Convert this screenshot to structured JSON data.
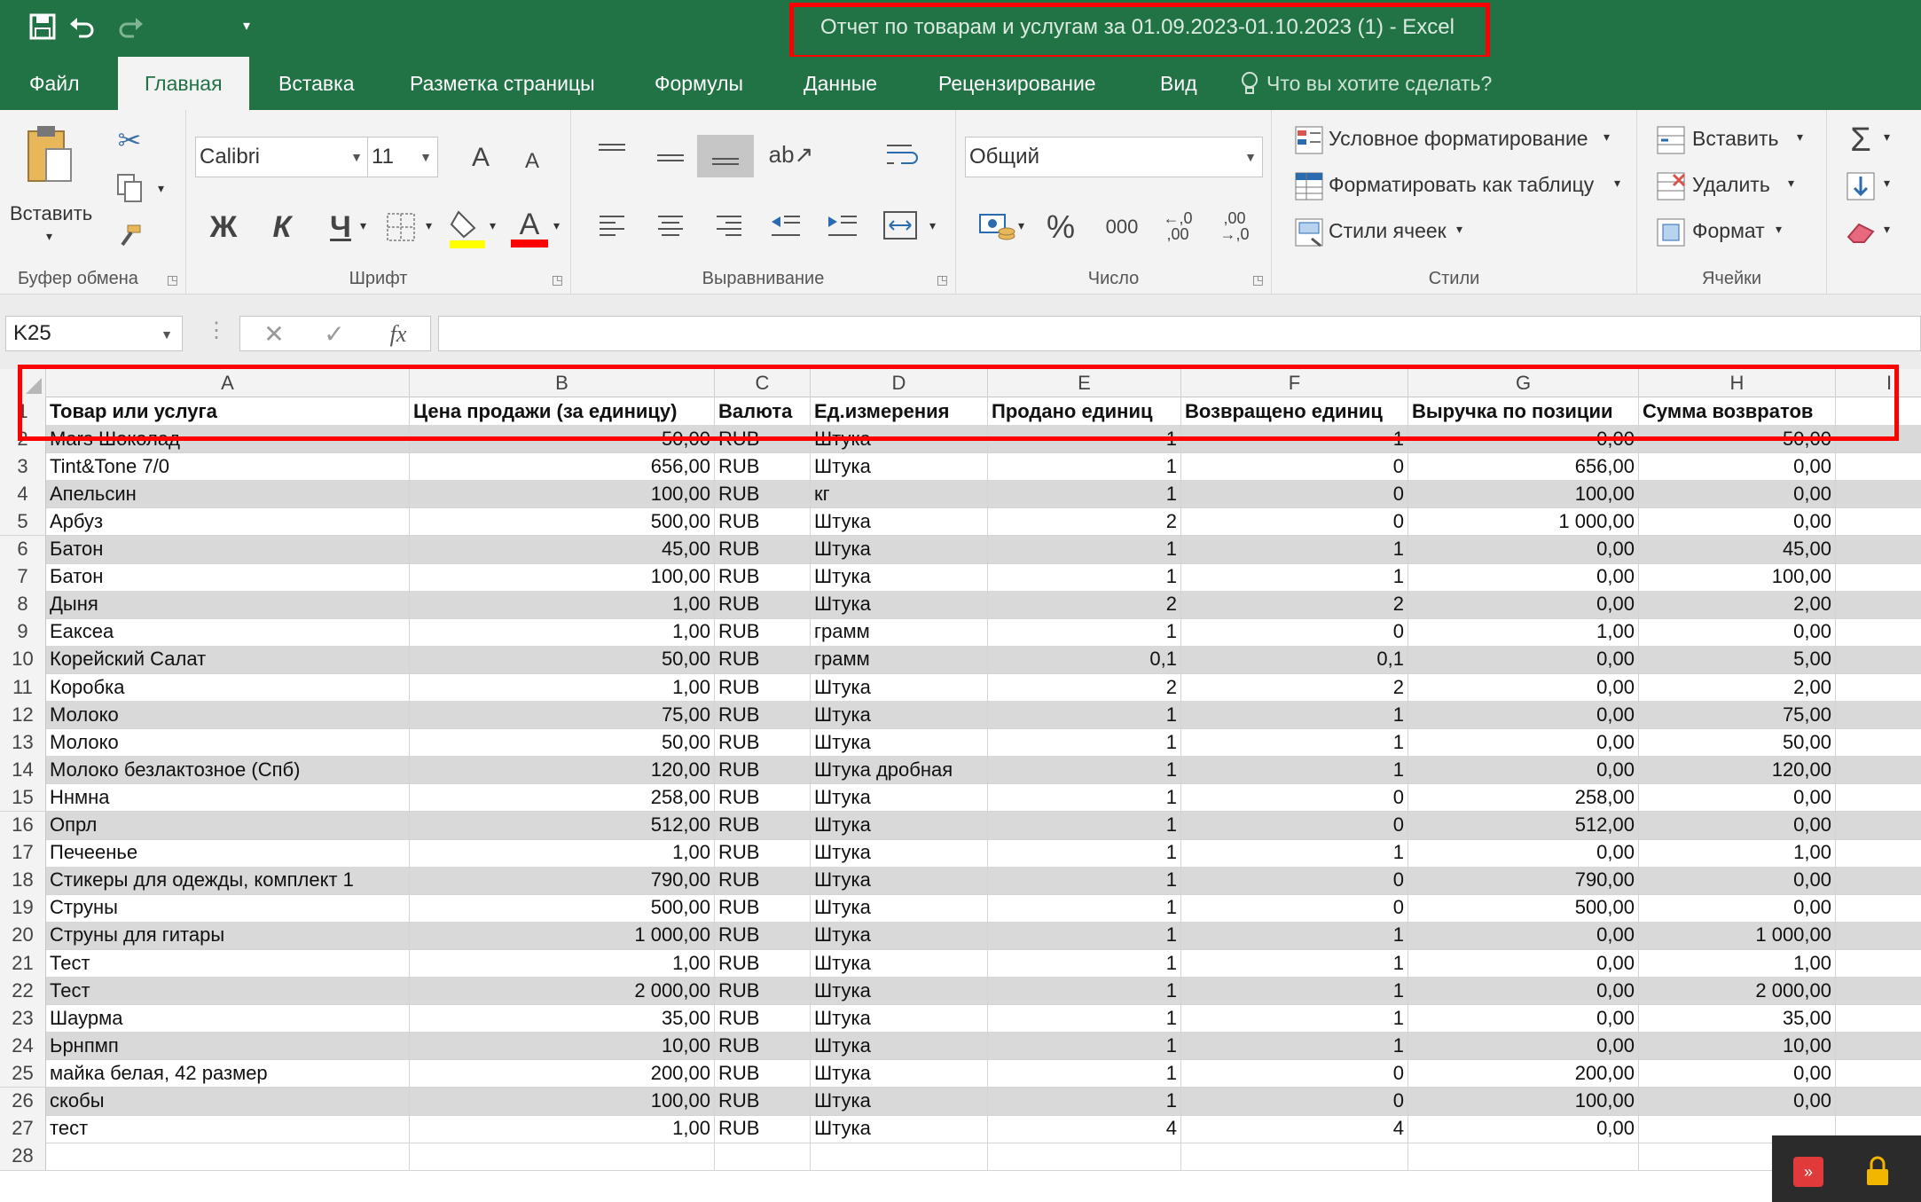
{
  "window": {
    "title": "Отчет по товарам и услугам за 01.09.2023-01.10.2023 (1)  -  Excel"
  },
  "quick_access": {
    "icons": [
      "save-icon",
      "undo-icon",
      "redo-icon",
      "customize-icon"
    ]
  },
  "tabs": [
    {
      "label": "Файл"
    },
    {
      "label": "Главная"
    },
    {
      "label": "Вставка"
    },
    {
      "label": "Разметка страницы"
    },
    {
      "label": "Формулы"
    },
    {
      "label": "Данные"
    },
    {
      "label": "Рецензирование"
    },
    {
      "label": "Вид"
    }
  ],
  "tell_me": "Что вы хотите сделать?",
  "ribbon": {
    "clipboard": {
      "paste_label": "Вставить",
      "group_label": "Буфер обмена"
    },
    "font": {
      "font_name": "Calibri",
      "font_size": "11",
      "bold_label": "Ж",
      "italic_label": "К",
      "underline_label": "Ч",
      "grow_label": "A",
      "shrink_label": "A",
      "font_color_label": "A",
      "group_label": "Шрифт",
      "fill_color": "#ffff00",
      "font_color": "#ff0000"
    },
    "alignment": {
      "group_label": "Выравнивание"
    },
    "number": {
      "format": "Общий",
      "percent_label": "%",
      "thousands_label": "000",
      "increase_decimal_label": "←,0\n,00",
      "decrease_decimal_label": ",00\n→,0",
      "group_label": "Число"
    },
    "styles": {
      "conditional": "Условное форматирование",
      "as_table": "Форматировать как таблицу",
      "cell_styles": "Стили ячеек",
      "group_label": "Стили"
    },
    "cells": {
      "insert": "Вставить",
      "delete": "Удалить",
      "format": "Формат",
      "group_label": "Ячейки"
    },
    "editing": {
      "sum_label": "Σ"
    }
  },
  "formula_bar": {
    "name_box": "K25",
    "cancel_label": "✕",
    "enter_label": "✓",
    "fx_label": "fx",
    "value": ""
  },
  "grid": {
    "columns": [
      "A",
      "B",
      "C",
      "D",
      "E",
      "F",
      "G",
      "H",
      "I"
    ],
    "header_row": {
      "num": "1",
      "cells": [
        "Товар или услуга",
        "Цена продажи (за единицу)",
        "Валюта",
        "Ед.измерения",
        "Продано единиц",
        "Возвращено единиц",
        "Выручка по позиции",
        "Сумма возвратов"
      ]
    },
    "rows": [
      {
        "num": "2",
        "cells": [
          "Mars Шоколад",
          "50,00",
          "RUB",
          "Штука",
          "1",
          "1",
          "0,00",
          "50,00"
        ]
      },
      {
        "num": "3",
        "cells": [
          "Tint&Tone 7/0",
          "656,00",
          "RUB",
          "Штука",
          "1",
          "0",
          "656,00",
          "0,00"
        ]
      },
      {
        "num": "4",
        "cells": [
          "Апельсин",
          "100,00",
          "RUB",
          "кг",
          "1",
          "0",
          "100,00",
          "0,00"
        ]
      },
      {
        "num": "5",
        "cells": [
          "Арбуз",
          "500,00",
          "RUB",
          "Штука",
          "2",
          "0",
          "1 000,00",
          "0,00"
        ]
      },
      {
        "num": "6",
        "cells": [
          "Батон",
          "45,00",
          "RUB",
          "Штука",
          "1",
          "1",
          "0,00",
          "45,00"
        ]
      },
      {
        "num": "7",
        "cells": [
          "Батон",
          "100,00",
          "RUB",
          "Штука",
          "1",
          "1",
          "0,00",
          "100,00"
        ]
      },
      {
        "num": "8",
        "cells": [
          "Дыня",
          "1,00",
          "RUB",
          "Штука",
          "2",
          "2",
          "0,00",
          "2,00"
        ]
      },
      {
        "num": "9",
        "cells": [
          "Еаксеа",
          "1,00",
          "RUB",
          "грамм",
          "1",
          "0",
          "1,00",
          "0,00"
        ]
      },
      {
        "num": "10",
        "cells": [
          "Корейский Салат",
          "50,00",
          "RUB",
          "грамм",
          "0,1",
          "0,1",
          "0,00",
          "5,00"
        ]
      },
      {
        "num": "11",
        "cells": [
          "Коробка",
          "1,00",
          "RUB",
          "Штука",
          "2",
          "2",
          "0,00",
          "2,00"
        ]
      },
      {
        "num": "12",
        "cells": [
          "Молоко",
          "75,00",
          "RUB",
          "Штука",
          "1",
          "1",
          "0,00",
          "75,00"
        ]
      },
      {
        "num": "13",
        "cells": [
          "Молоко",
          "50,00",
          "RUB",
          "Штука",
          "1",
          "1",
          "0,00",
          "50,00"
        ]
      },
      {
        "num": "14",
        "cells": [
          "Молоко безлактозное (Спб)",
          "120,00",
          "RUB",
          "Штука дробная",
          "1",
          "1",
          "0,00",
          "120,00"
        ]
      },
      {
        "num": "15",
        "cells": [
          "Ннмна",
          "258,00",
          "RUB",
          "Штука",
          "1",
          "0",
          "258,00",
          "0,00"
        ]
      },
      {
        "num": "16",
        "cells": [
          "Опрл",
          "512,00",
          "RUB",
          "Штука",
          "1",
          "0",
          "512,00",
          "0,00"
        ]
      },
      {
        "num": "17",
        "cells": [
          "Печеенье",
          "1,00",
          "RUB",
          "Штука",
          "1",
          "1",
          "0,00",
          "1,00"
        ]
      },
      {
        "num": "18",
        "cells": [
          "Стикеры для одежды, комплект 1",
          "790,00",
          "RUB",
          "Штука",
          "1",
          "0",
          "790,00",
          "0,00"
        ]
      },
      {
        "num": "19",
        "cells": [
          "Струны",
          "500,00",
          "RUB",
          "Штука",
          "1",
          "0",
          "500,00",
          "0,00"
        ]
      },
      {
        "num": "20",
        "cells": [
          "Струны для гитары",
          "1 000,00",
          "RUB",
          "Штука",
          "1",
          "1",
          "0,00",
          "1 000,00"
        ]
      },
      {
        "num": "21",
        "cells": [
          "Тест",
          "1,00",
          "RUB",
          "Штука",
          "1",
          "1",
          "0,00",
          "1,00"
        ]
      },
      {
        "num": "22",
        "cells": [
          "Тест",
          "2 000,00",
          "RUB",
          "Штука",
          "1",
          "1",
          "0,00",
          "2 000,00"
        ]
      },
      {
        "num": "23",
        "cells": [
          "Шаурма",
          "35,00",
          "RUB",
          "Штука",
          "1",
          "1",
          "0,00",
          "35,00"
        ]
      },
      {
        "num": "24",
        "cells": [
          "Ьрнпмп",
          "10,00",
          "RUB",
          "Штука",
          "1",
          "1",
          "0,00",
          "10,00"
        ]
      },
      {
        "num": "25",
        "cells": [
          "майка белая, 42 размер",
          "200,00",
          "RUB",
          "Штука",
          "1",
          "0",
          "200,00",
          "0,00"
        ]
      },
      {
        "num": "26",
        "cells": [
          "скобы",
          "100,00",
          "RUB",
          "Штука",
          "1",
          "0",
          "100,00",
          "0,00"
        ]
      },
      {
        "num": "27",
        "cells": [
          "тест",
          "1,00",
          "RUB",
          "Штука",
          "4",
          "4",
          "0,00",
          ""
        ]
      },
      {
        "num": "28",
        "cells": [
          "",
          "",
          "",
          "",
          "",
          "",
          "",
          ""
        ]
      }
    ]
  },
  "colors": {
    "excel_green": "#217346",
    "highlight_red": "#ff0000",
    "row_shade": "#d9d9d9"
  }
}
